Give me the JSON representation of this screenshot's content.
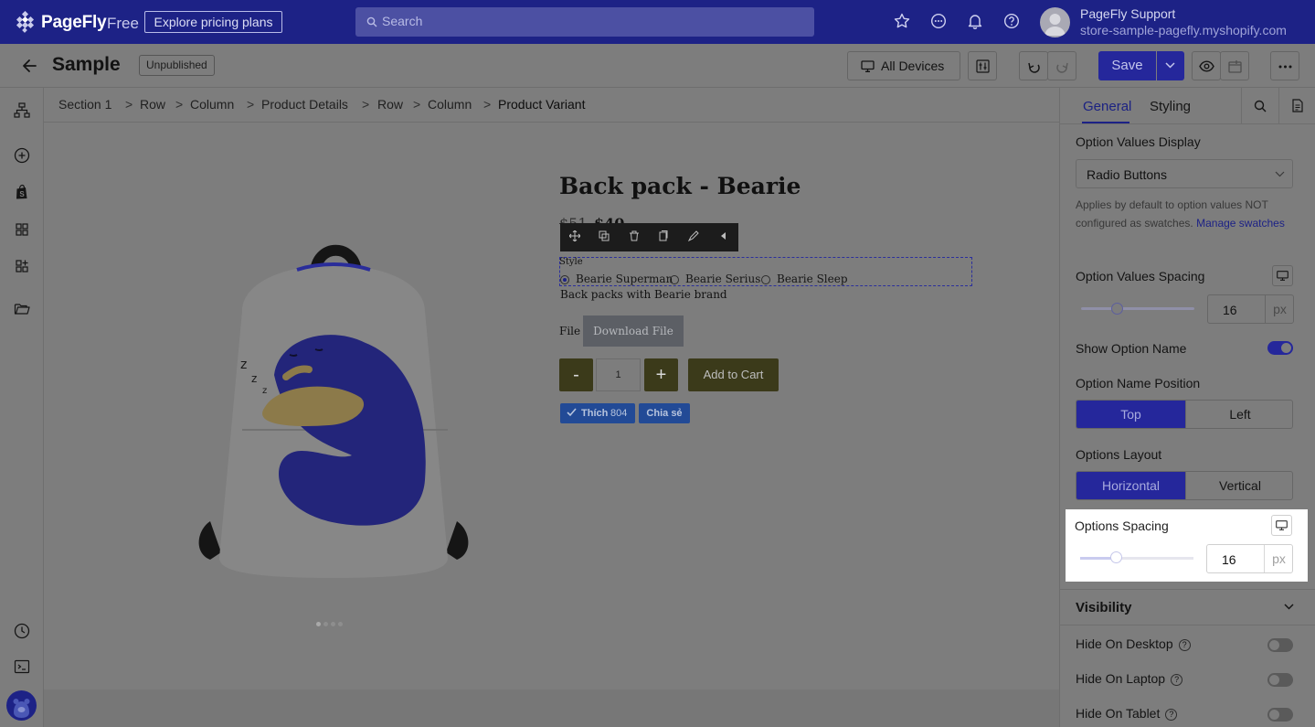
{
  "topbar": {
    "logo_text": "PageFly",
    "logo_free": "Free",
    "pricing_button": "Explore pricing plans",
    "search_placeholder": "Search",
    "user_name": "PageFly Support",
    "user_store": "store-sample-pagefly.myshopify.com"
  },
  "editbar": {
    "title": "Sample",
    "status": "Unpublished",
    "devices_label": "All Devices",
    "save_label": "Save"
  },
  "breadcrumb": [
    "Section 1",
    "Row",
    "Column",
    "Product Details",
    "Row",
    "Column",
    "Product Variant"
  ],
  "breadcrumb_separator": ">",
  "product": {
    "title": "Back pack - Bearie",
    "old_price": "$51",
    "new_price": "$40",
    "option_name": "Style",
    "options": [
      "Bearie Superman",
      "Bearie Serius",
      "Bearie Sleep"
    ],
    "selected_option": "Bearie Superman",
    "description": "Back packs with Bearie brand",
    "file_label": "File",
    "download_label": "Download File",
    "quantity": "1",
    "minus_label": "-",
    "plus_label": "+",
    "add_to_cart": "Add to Cart",
    "like_label": "Thích",
    "like_count": "804",
    "share_label": "Chia sẻ"
  },
  "panel": {
    "tabs": [
      "General",
      "Styling"
    ],
    "active_tab": "General",
    "option_values_display_label": "Option Values Display",
    "option_values_display_value": "Radio Buttons",
    "help_text": "Applies by default to option values NOT configured as swatches.",
    "help_link": "Manage swatches",
    "option_values_spacing_label": "Option Values Spacing",
    "option_values_spacing_value": "16",
    "unit": "px",
    "show_option_name_label": "Show Option Name",
    "show_option_name_on": true,
    "option_name_position_label": "Option Name Position",
    "position_options": [
      "Top",
      "Left"
    ],
    "position_selected": "Top",
    "options_layout_label": "Options Layout",
    "layout_options": [
      "Horizontal",
      "Vertical"
    ],
    "layout_selected": "Horizontal",
    "options_spacing_label": "Options Spacing",
    "options_spacing_value": "16",
    "visibility_title": "Visibility",
    "visibility_rows": [
      "Hide On Desktop",
      "Hide On Laptop",
      "Hide On Tablet"
    ],
    "visibility_values": [
      false,
      false,
      false
    ]
  },
  "colors": {
    "brand": "#1d2286",
    "overlay": "#7d7d7d",
    "highlight": "#ffffff"
  },
  "icons": [
    "logo-icon",
    "search-icon",
    "star-icon",
    "chat-icon",
    "bell-icon",
    "help-icon",
    "back-arrow-icon",
    "desktop-icon",
    "sliders-icon",
    "undo-icon",
    "redo-icon",
    "chevron-down-icon",
    "eye-icon",
    "publish-icon",
    "more-icon",
    "layers-icon",
    "add-icon",
    "shopify-icon",
    "grid-icon",
    "apps-icon",
    "folder-icon",
    "history-icon",
    "terminal-icon",
    "move-icon",
    "duplicate-icon",
    "delete-icon",
    "copy-icon",
    "paint-icon",
    "collapse-icon"
  ]
}
